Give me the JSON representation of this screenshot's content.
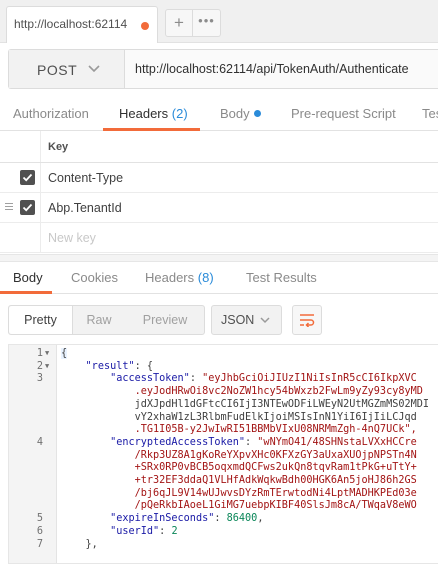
{
  "tab": {
    "title": "http://localhost:62114",
    "add_label": "+",
    "more_label": "•••"
  },
  "request": {
    "method": "POST",
    "url": "http://localhost:62114/api/TokenAuth/Authenticate"
  },
  "request_tabs": [
    {
      "label": "Authorization"
    },
    {
      "label": "Headers",
      "count": "(2)"
    },
    {
      "label": "Body"
    },
    {
      "label": "Pre-request Script"
    },
    {
      "label": "Tes"
    }
  ],
  "headers_table": {
    "key_column": "Key",
    "rows": [
      {
        "key": "Content-Type",
        "checked": true
      },
      {
        "key": "Abp.TenantId",
        "checked": true
      }
    ],
    "placeholder": "New key"
  },
  "response_tabs": [
    {
      "label": "Body"
    },
    {
      "label": "Cookies"
    },
    {
      "label": "Headers",
      "count": "(8)"
    },
    {
      "label": "Test Results"
    }
  ],
  "view_modes": [
    "Pretty",
    "Raw",
    "Preview"
  ],
  "format": "JSON",
  "colors": {
    "accent": "#f26b3a",
    "link_blue": "#2a8bd9"
  },
  "code_lines": [
    {
      "n": "1",
      "fold": "▼",
      "text": "{"
    },
    {
      "n": "2",
      "fold": "▼",
      "text": "    \"result\": {"
    },
    {
      "n": "3",
      "fold": "",
      "text": "        \"accessToken\": \"eyJhbGciOiJIUzI1NiIsInR5cCI6IkpXVC"
    },
    {
      "n": "",
      "fold": "",
      "text": "            .eyJodHRwOi8vc2NoZW1hcy54bWxzb2FwLm9yZy93cy8yMD"
    },
    {
      "n": "",
      "fold": "",
      "text": "            jdXJpdHl1dGFtcCI6IjI3NTEwODFiLWEyN2UtMGZmMS02MDI"
    },
    {
      "n": "",
      "fold": "",
      "text": "            vY2xhaW1zL3RlbmFudElkIjoiMSIsInN1YiI6IjIiLCJqd"
    },
    {
      "n": "",
      "fold": "",
      "text": "            .TG1I05B-y2JwIwRI51BBMbVIxU08NRMmZgh-4nQ7UCk\","
    },
    {
      "n": "4",
      "fold": "",
      "text": "        \"encryptedAccessToken\": \"wNYmO41/48SHNstaLVXxHCCre"
    },
    {
      "n": "",
      "fold": "",
      "text": "            /Rkp3UZ8A1gKoReYXpvXHc0KFXzGY3aUxaXUOjpNPSTn4N"
    },
    {
      "n": "",
      "fold": "",
      "text": "            +SRx0RP0vBCB5oqxmdQCFws2ukQn8tqvRam1tPkG+uTtY+"
    },
    {
      "n": "",
      "fold": "",
      "text": "            +tr32EF3ddaQ1VLHfAdkWqkwBdh00HGK6An5joHJ86h2GS"
    },
    {
      "n": "",
      "fold": "",
      "text": "            /bj6qJL9V14wUJwvsDYzRmTErwtodNi4LptMADHKPEd03e"
    },
    {
      "n": "",
      "fold": "",
      "text": "            /pQeRkbIAoeL1GiMG7uebpKIBF40SlsJm8cA/TWqaV8eWO"
    },
    {
      "n": "5",
      "fold": "",
      "text": "        \"expireInSeconds\": 86400,"
    },
    {
      "n": "6",
      "fold": "",
      "text": "        \"userId\": 2"
    },
    {
      "n": "7",
      "fold": "",
      "text": "    },"
    }
  ]
}
